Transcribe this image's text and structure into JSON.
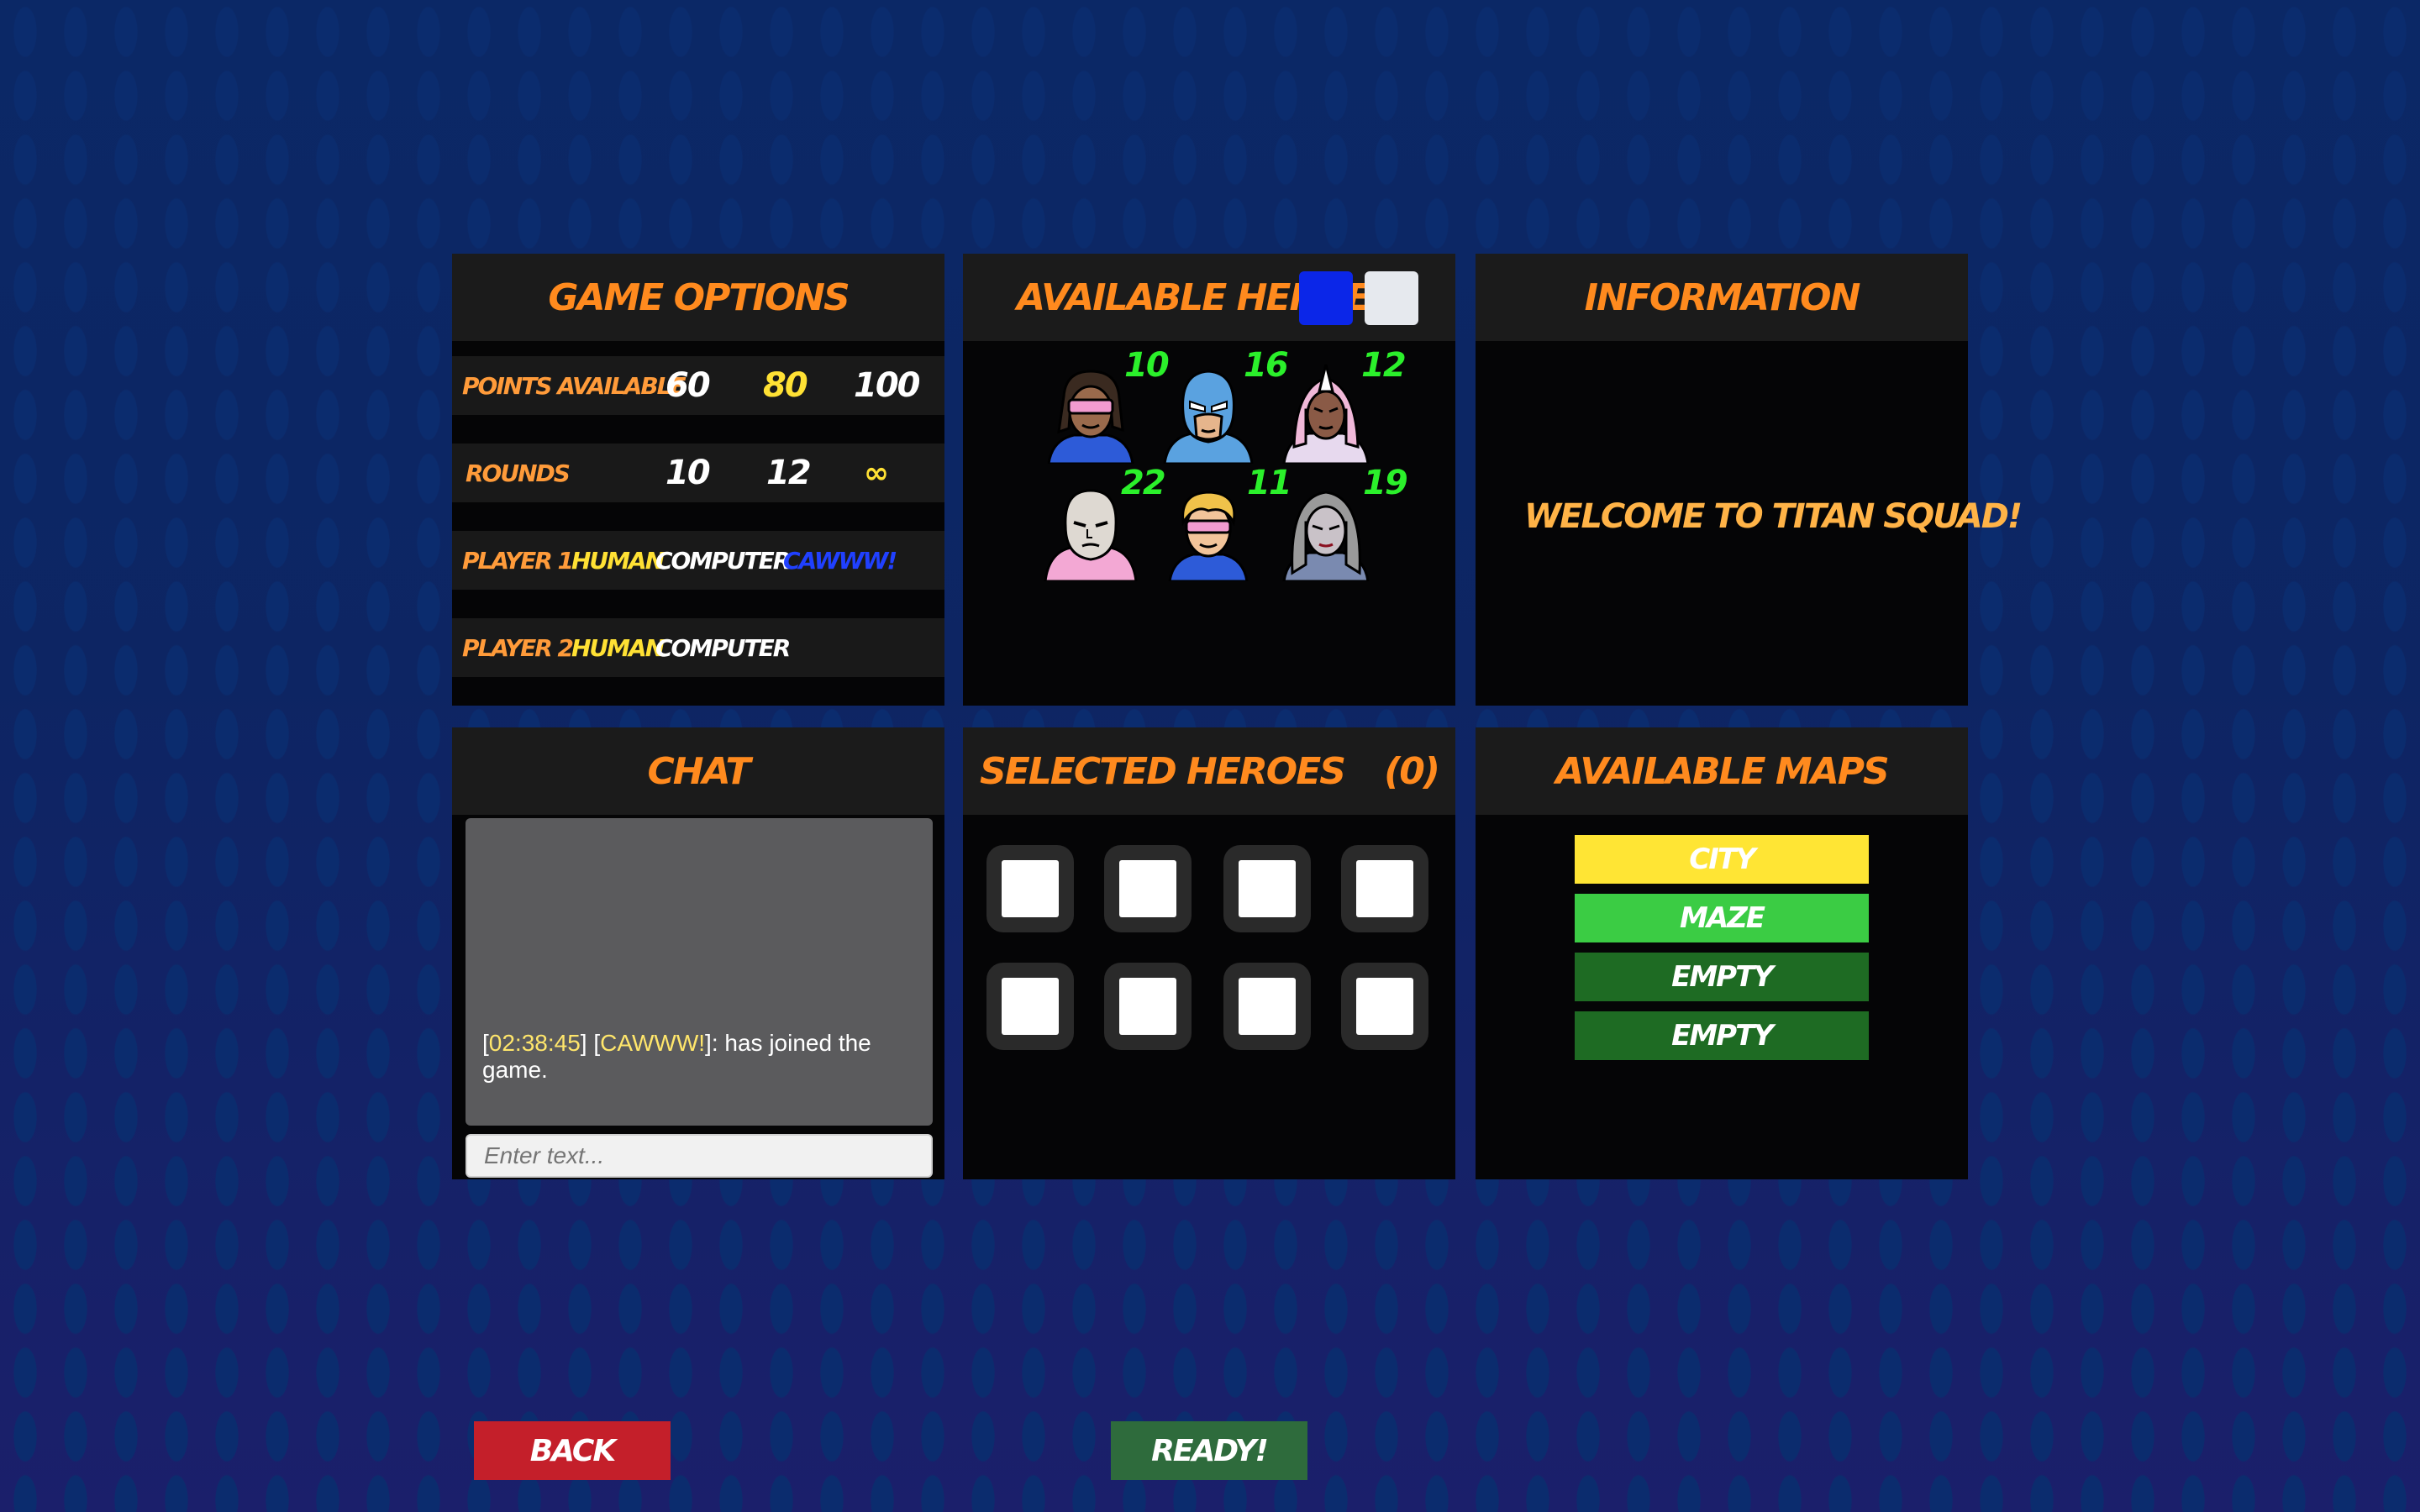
{
  "game_options": {
    "title": "GAME OPTIONS",
    "points": {
      "label": "POINTS AVAILABLE",
      "options": [
        "60",
        "80",
        "100"
      ],
      "selected": "80"
    },
    "rounds": {
      "label": "ROUNDS",
      "options": [
        "10",
        "12",
        "∞"
      ],
      "selected": "∞"
    },
    "player1": {
      "label": "PLAYER 1",
      "options": [
        "HUMAN",
        "COMPUTER"
      ],
      "selected": "HUMAN",
      "name": "CAWWW!"
    },
    "player2": {
      "label": "PLAYER 2",
      "options": [
        "HUMAN",
        "COMPUTER"
      ],
      "selected": "HUMAN"
    }
  },
  "available_heroes": {
    "title": "AVAILABLE HEROES",
    "team_colors": [
      "#0b26e8",
      "#e6e9ee"
    ],
    "heroes": [
      {
        "icon": "hero-visor-dreadlocks-portrait",
        "cost": "10"
      },
      {
        "icon": "hero-blue-masked-portrait",
        "cost": "16"
      },
      {
        "icon": "hero-winged-helmet-portrait",
        "cost": "12"
      },
      {
        "icon": "hero-bald-pale-portrait",
        "cost": "22"
      },
      {
        "icon": "hero-blonde-visor-portrait",
        "cost": "11"
      },
      {
        "icon": "hero-grey-haired-woman-portrait",
        "cost": "19"
      }
    ]
  },
  "information": {
    "title": "INFORMATION",
    "message": "WELCOME TO TITAN SQUAD!"
  },
  "chat": {
    "title": "CHAT",
    "messages": [
      {
        "time": "02:38:45",
        "user": "CAWWW!",
        "text": "has joined the game."
      }
    ],
    "input_placeholder": "Enter text..."
  },
  "selected_heroes": {
    "title": "SELECTED HEROES",
    "count": "(0)",
    "slots": 8
  },
  "available_maps": {
    "title": "AVAILABLE MAPS",
    "maps": [
      {
        "name": "CITY",
        "color": "#ffe534",
        "state": "selected"
      },
      {
        "name": "MAZE",
        "color": "#3bcc44",
        "state": "available"
      },
      {
        "name": "EMPTY",
        "color": "#1e6b23",
        "state": "empty"
      },
      {
        "name": "EMPTY",
        "color": "#1e6b23",
        "state": "empty"
      }
    ]
  },
  "buttons": {
    "back": "BACK",
    "ready": "READY!",
    "back_color": "#c41f2a",
    "ready_color": "#2e6b3c"
  }
}
